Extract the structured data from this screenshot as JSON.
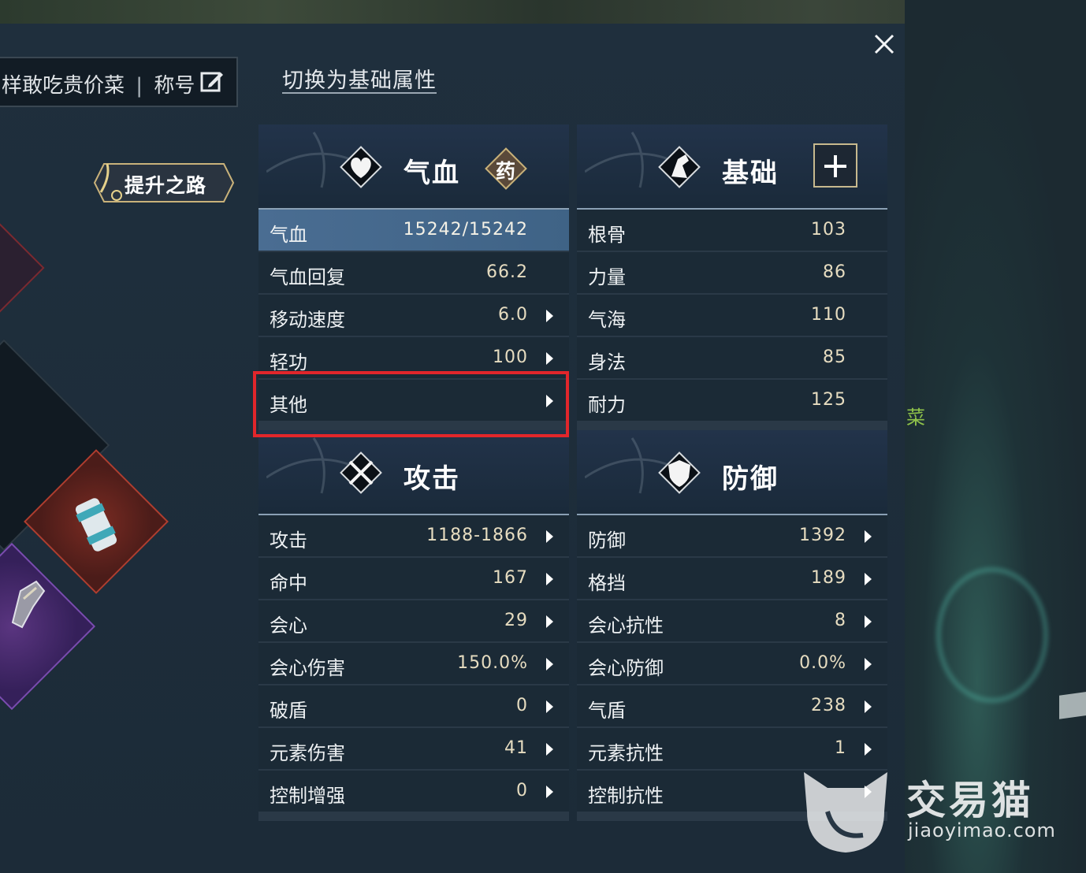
{
  "header": {
    "player_name": "样敢吃贵价菜",
    "separator": "|",
    "title_label": "称号",
    "switch_link": "切换为基础属性",
    "promote_button": "提升之路"
  },
  "background": {
    "side_text": "菜"
  },
  "sections": {
    "qixue": {
      "title": "气血",
      "badge": "药",
      "rows": [
        {
          "label": "气血",
          "value": "15242/15242"
        },
        {
          "label": "气血回复",
          "value": "66.2"
        },
        {
          "label": "移动速度",
          "value": "6.0"
        },
        {
          "label": "轻功",
          "value": "100"
        },
        {
          "label": "其他",
          "value": ""
        }
      ]
    },
    "jichu": {
      "title": "基础",
      "rows": [
        {
          "label": "根骨",
          "value": "103"
        },
        {
          "label": "力量",
          "value": "86"
        },
        {
          "label": "气海",
          "value": "110"
        },
        {
          "label": "身法",
          "value": "85"
        },
        {
          "label": "耐力",
          "value": "125"
        }
      ]
    },
    "gongji": {
      "title": "攻击",
      "rows": [
        {
          "label": "攻击",
          "value": "1188-1866"
        },
        {
          "label": "命中",
          "value": "167"
        },
        {
          "label": "会心",
          "value": "29"
        },
        {
          "label": "会心伤害",
          "value": "150.0%"
        },
        {
          "label": "破盾",
          "value": "0"
        },
        {
          "label": "元素伤害",
          "value": "41"
        },
        {
          "label": "控制增强",
          "value": "0"
        }
      ]
    },
    "fangyu": {
      "title": "防御",
      "rows": [
        {
          "label": "防御",
          "value": "1392"
        },
        {
          "label": "格挡",
          "value": "189"
        },
        {
          "label": "会心抗性",
          "value": "8"
        },
        {
          "label": "会心防御",
          "value": "0.0%"
        },
        {
          "label": "气盾",
          "value": "238"
        },
        {
          "label": "元素抗性",
          "value": "1"
        },
        {
          "label": "控制抗性",
          "value": ""
        }
      ]
    }
  },
  "watermark": {
    "cn": "交易猫",
    "en": "jiaoyimao.com"
  },
  "colors": {
    "highlight_row": "#4a6d92",
    "annotation_box": "#e1262b",
    "value_text": "#e6dcc0"
  }
}
